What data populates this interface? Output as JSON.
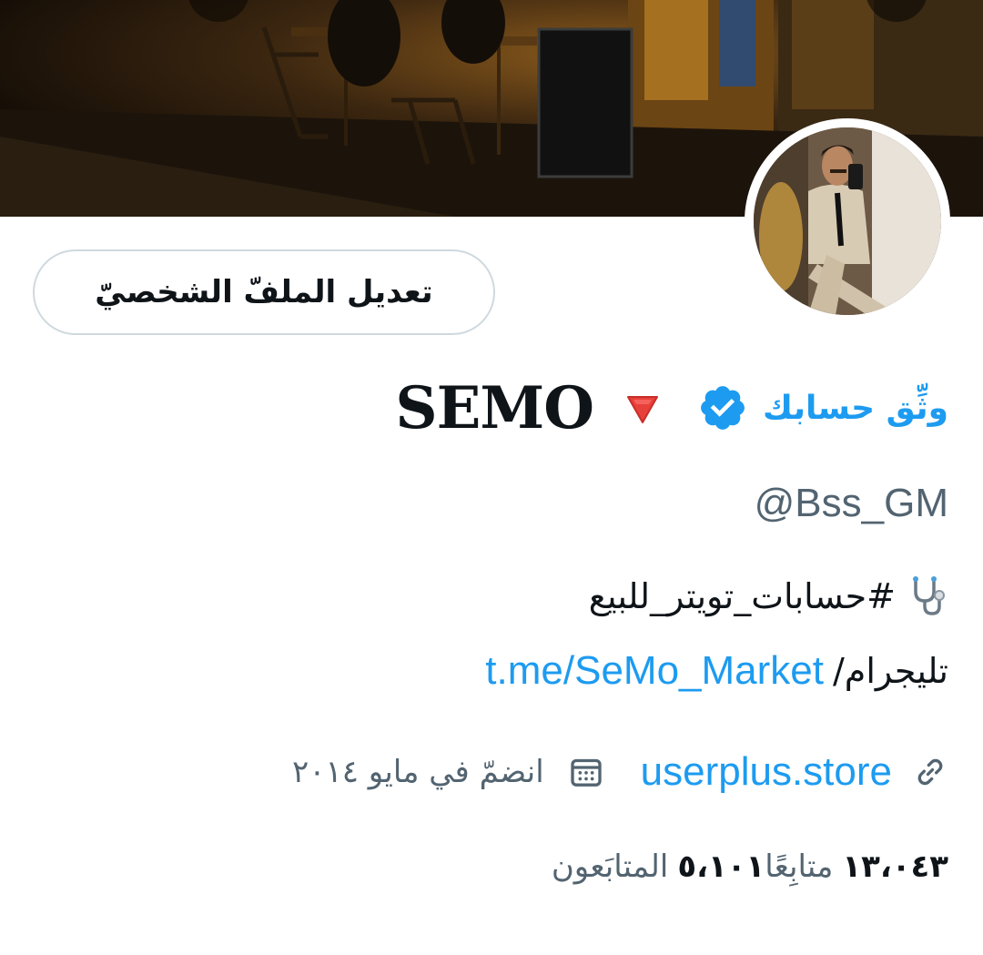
{
  "profile": {
    "edit_button": "تعديل الملفّ الشخصيّ",
    "verify_link": "وثِّق حسابك",
    "display_name": "SEMO",
    "handle": "@Bss_GM",
    "bio_hashtag": "#حسابات_تويتر_للبيع",
    "bio_telegram_label": "تليجرام/",
    "bio_telegram_link": "t.me/SeMo_Market",
    "website": "userplus.store",
    "joined": "انضمّ في مايو ٢٠١٤",
    "following_count": "٥،١٠١",
    "following_label": "المتابَعون",
    "followers_count": "١٣،٠٤٣",
    "followers_label": "متابِعًا"
  },
  "icons": {
    "verified": "verified-badge-icon",
    "name_emoji": "red-triangle-down-icon",
    "bio_emoji": "stethoscope-icon",
    "website": "link-icon",
    "joined": "calendar-icon"
  },
  "colors": {
    "accent": "#1d9bf0",
    "secondary_text": "#536471",
    "primary_text": "#0f1419",
    "button_border": "#cfd9de"
  }
}
